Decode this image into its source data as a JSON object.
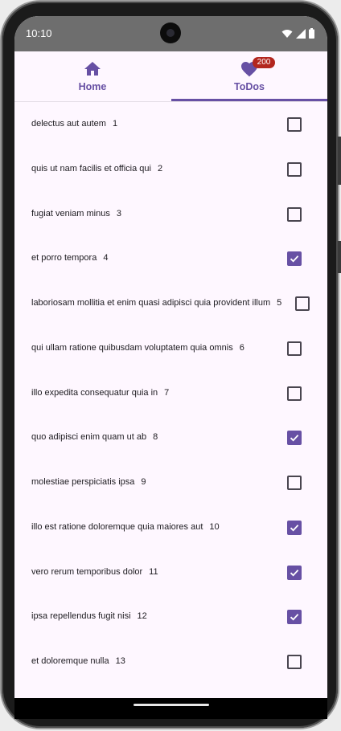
{
  "status_bar": {
    "time": "10:10",
    "icons": [
      "wifi-icon",
      "cell-signal-icon",
      "battery-icon"
    ]
  },
  "tabs": [
    {
      "label": "Home",
      "icon": "home-icon",
      "selected": false
    },
    {
      "label": "ToDos",
      "icon": "heart-icon",
      "selected": true,
      "badge": "200"
    }
  ],
  "colors": {
    "accent": "#6750a4",
    "badge": "#b3261e",
    "background": "#fef7ff",
    "status_bar": "#6e6e6e"
  },
  "todos": [
    {
      "title": "delectus aut autem",
      "id": "1",
      "checked": false
    },
    {
      "title": "quis ut nam facilis et officia qui",
      "id": "2",
      "checked": false
    },
    {
      "title": "fugiat veniam minus",
      "id": "3",
      "checked": false
    },
    {
      "title": "et porro tempora",
      "id": "4",
      "checked": true
    },
    {
      "title": "laboriosam mollitia et enim quasi adipisci quia provident illum",
      "id": "5",
      "checked": false
    },
    {
      "title": "qui ullam ratione quibusdam voluptatem quia omnis",
      "id": "6",
      "checked": false
    },
    {
      "title": "illo expedita consequatur quia in",
      "id": "7",
      "checked": false
    },
    {
      "title": "quo adipisci enim quam ut ab",
      "id": "8",
      "checked": true
    },
    {
      "title": "molestiae perspiciatis ipsa",
      "id": "9",
      "checked": false
    },
    {
      "title": "illo est ratione doloremque quia maiores aut",
      "id": "10",
      "checked": true
    },
    {
      "title": "vero rerum temporibus dolor",
      "id": "11",
      "checked": true
    },
    {
      "title": "ipsa repellendus fugit nisi",
      "id": "12",
      "checked": true
    },
    {
      "title": "et doloremque nulla",
      "id": "13",
      "checked": false
    }
  ]
}
